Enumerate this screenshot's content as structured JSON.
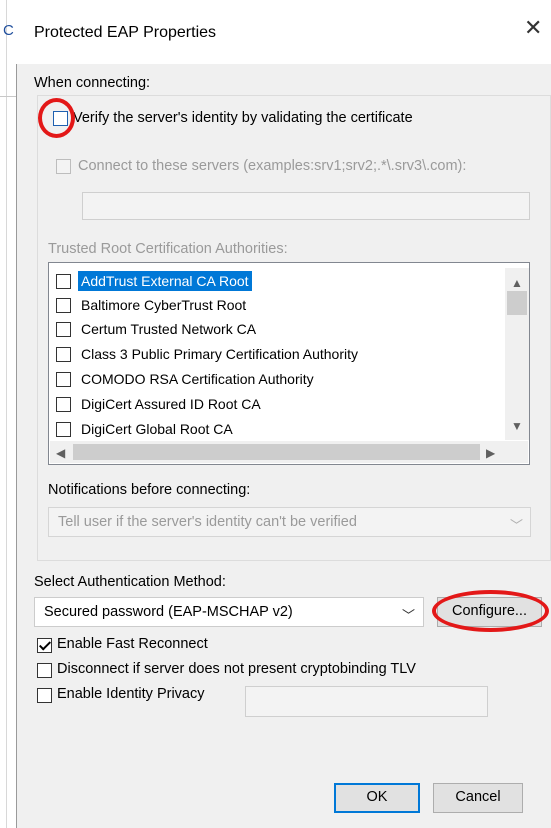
{
  "background_window": {
    "letter": "C"
  },
  "dialog": {
    "title": "Protected EAP Properties",
    "close_glyph": "✕"
  },
  "when_connecting": {
    "label": "When connecting:",
    "verify_label": "Verify the server's identity by validating the certificate",
    "verify_checked": false,
    "connect_servers_label": "Connect to these servers (examples:srv1;srv2;.*\\.srv3\\.com):",
    "connect_servers_checked": false,
    "servers_value": ""
  },
  "trusted_roots": {
    "label": "Trusted Root Certification Authorities:",
    "items": [
      {
        "label": "AddTrust External CA Root",
        "checked": false,
        "selected": true
      },
      {
        "label": "Baltimore CyberTrust Root",
        "checked": false,
        "selected": false
      },
      {
        "label": "Certum Trusted Network CA",
        "checked": false,
        "selected": false
      },
      {
        "label": "Class 3 Public Primary Certification Authority",
        "checked": false,
        "selected": false
      },
      {
        "label": "COMODO RSA Certification Authority",
        "checked": false,
        "selected": false
      },
      {
        "label": "DigiCert Assured ID Root CA",
        "checked": false,
        "selected": false
      },
      {
        "label": "DigiCert Global Root CA",
        "checked": false,
        "selected": false
      }
    ]
  },
  "notifications": {
    "label": "Notifications before connecting:",
    "selected": "Tell user if the server's identity can't be verified"
  },
  "auth_method": {
    "label": "Select Authentication Method:",
    "selected": "Secured password (EAP-MSCHAP v2)",
    "configure_label": "Configure..."
  },
  "options": [
    {
      "label": "Enable Fast Reconnect",
      "checked": true
    },
    {
      "label": "Disconnect if server does not present cryptobinding TLV",
      "checked": false
    },
    {
      "label": "Enable Identity Privacy",
      "checked": false
    }
  ],
  "identity_value": "",
  "buttons": {
    "ok": "OK",
    "cancel": "Cancel"
  },
  "icons": {
    "scroll_up": "▲",
    "scroll_down": "▼",
    "scroll_left": "◀",
    "scroll_right": "▶",
    "combo_down": "﹀"
  },
  "colors": {
    "selection": "#0078d7",
    "annotation_red": "#e31818",
    "disabled_text": "#9a9a9a"
  }
}
